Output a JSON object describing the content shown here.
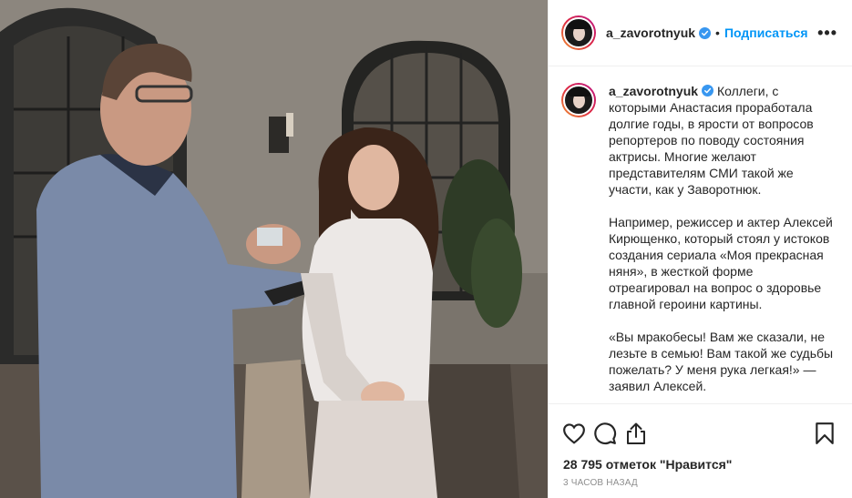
{
  "header": {
    "username": "a_zavorotnyuk",
    "separator": "•",
    "follow_label": "Подписаться",
    "more_label": "•••"
  },
  "caption": {
    "username": "a_zavorotnyuk",
    "text": "Коллеги, с которыми Анастасия проработала долгие годы, в ярости от вопросов репортеров по поводу состояния актрисы. Многие желают представителям СМИ такой же участи, как у Заворотнюк.\n\nНапример, режиссер и актер Алексей Кирющенко, который стоял у истоков создания сериала «Моя прекрасная няня», в жесткой форме отреагировал на вопрос о здоровье главной героини картины.\n\n«Вы мракобесы! Вам же сказали, не лезьте в семью! Вам такой же судьбы пожелать? У меня рука легкая!» — заявил Алексей."
  },
  "actions": {
    "icons": [
      "heart-icon",
      "comment-icon",
      "share-icon",
      "bookmark-icon"
    ]
  },
  "likes_label": "28 795 отметок \"Нравится\"",
  "time_label": "3 часов назад",
  "colors": {
    "accent": "#0095f6",
    "verified": "#3897f0",
    "text": "#262626",
    "muted": "#8e8e8e",
    "border": "#efefef"
  }
}
